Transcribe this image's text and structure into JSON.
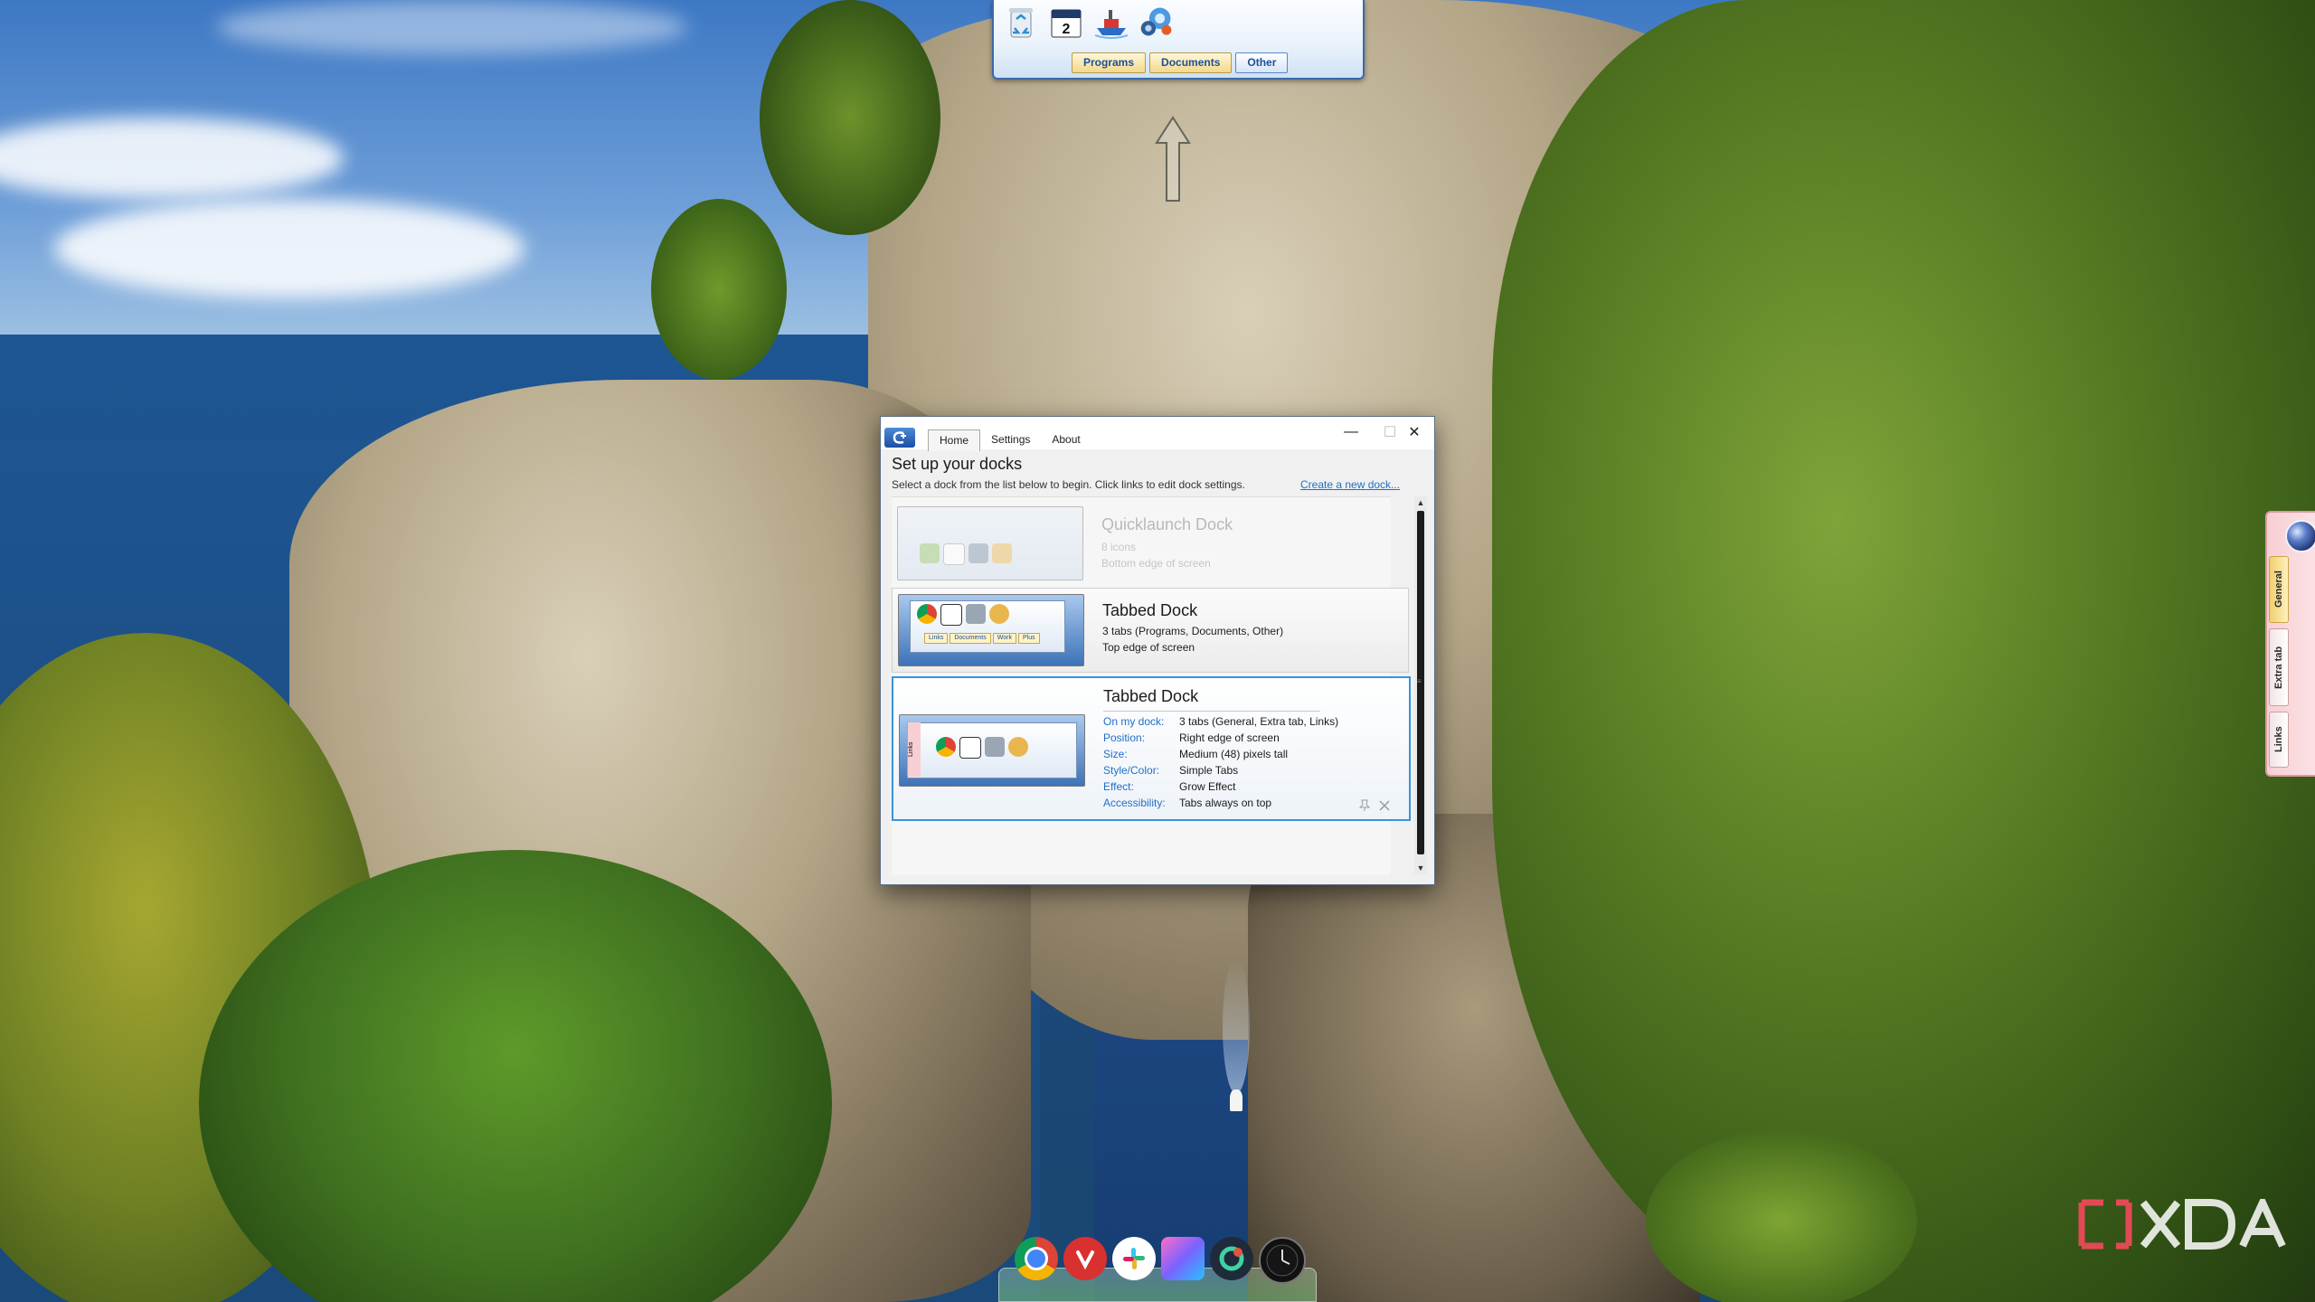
{
  "top_dock": {
    "calendar_day": "2",
    "tabs": [
      "Programs",
      "Documents",
      "Other"
    ],
    "icons": [
      "recycle-bin-icon",
      "calendar-icon",
      "ship-icon",
      "settings-gear-icon"
    ]
  },
  "right_dock": {
    "tabs": [
      "General",
      "Extra tab",
      "Links"
    ]
  },
  "bottom_dock": {
    "icons": [
      "chrome-icon",
      "vivaldi-icon",
      "slack-icon",
      "feather-icon",
      "circle-dock-icon",
      "clock-icon"
    ]
  },
  "window": {
    "tabs": [
      "Home",
      "Settings",
      "About"
    ],
    "active_tab": "Home",
    "controls": {
      "minimize": "—",
      "maximize": "☐",
      "close": "✕"
    },
    "header": {
      "title": "Set up your docks",
      "description": "Select a dock from the list below to begin. Click links to edit dock settings.",
      "create_link": "Create a new dock..."
    },
    "docks": [
      {
        "name": "Quicklaunch Dock",
        "line1": "8 icons",
        "line2": "Bottom edge of screen"
      },
      {
        "name": "Tabbed Dock",
        "line1": "3 tabs (Programs, Documents, Other)",
        "line2": "Top edge of screen",
        "thumb_tabs": [
          "Links",
          "Documents",
          "Work",
          "Plus"
        ]
      },
      {
        "name": "Tabbed Dock",
        "thumb_tab": "Links",
        "properties": [
          {
            "key": "On my dock:",
            "value": "3 tabs (General, Extra tab, Links)"
          },
          {
            "key": "Position:",
            "value": "Right edge of screen"
          },
          {
            "key": "Size:",
            "value": "Medium (48) pixels tall"
          },
          {
            "key": "Style/Color:",
            "value": "Simple Tabs"
          },
          {
            "key": "Effect:",
            "value": "Grow Effect"
          },
          {
            "key": "Accessibility:",
            "value": "Tabs always on top"
          }
        ]
      }
    ],
    "scroll": {
      "up": "▲",
      "down": "▼",
      "grip": "≡"
    }
  }
}
